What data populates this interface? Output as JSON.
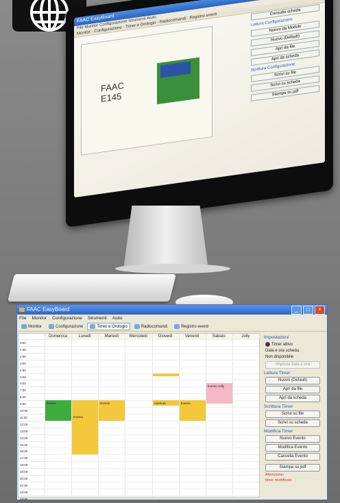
{
  "monitor": {
    "app_title": "FAAC EasyBoard",
    "menu": [
      "File",
      "Monitor",
      "Configurazione",
      "Strumenti",
      "Aiuto"
    ],
    "tabs": [
      "Monitor",
      "Configurazione",
      "Timer e Orologio",
      "Radiocomandi",
      "Registro eventi"
    ],
    "board_label": "FAAC\nE145",
    "side_sections": [
      {
        "title": "",
        "buttons": [
          "Consulta scheda"
        ]
      },
      {
        "title": "Lettura Configurazione",
        "buttons": [
          "Nuovo da Modulo",
          "Nuovo (Default)",
          "Apri da file",
          "Apri da scheda"
        ]
      },
      {
        "title": "Scrittura Configurazione",
        "buttons": [
          "Scrivi su file",
          "Scrivi su scheda"
        ]
      },
      {
        "title": "",
        "buttons": [
          "Stampa su pdf"
        ]
      }
    ]
  },
  "app": {
    "title": "FAAC EasyBoard",
    "menu": [
      "File",
      "Monitor",
      "Configurazione",
      "Strumenti",
      "Aiuto"
    ],
    "tabs": [
      {
        "label": "Monitor",
        "active": false
      },
      {
        "label": "Configurazione",
        "active": false
      },
      {
        "label": "Timer e Orologio",
        "active": true
      },
      {
        "label": "Radiocomandi",
        "active": false
      },
      {
        "label": "Registro eventi",
        "active": false
      }
    ],
    "days": [
      "Domenica",
      "Lunedì",
      "Martedì",
      "Mercoledì",
      "Giovedì",
      "Venerdì",
      "Sabato",
      "Jolly"
    ],
    "times": [
      "0:00",
      "1:00",
      "2:00",
      "3:00",
      "4:00",
      "5:00",
      "6:00",
      "7:00",
      "8:00",
      "9:00",
      "10:00",
      "11:00",
      "12:00",
      "13:00",
      "14:00",
      "15:00",
      "16:00",
      "17:00",
      "18:00",
      "19:00",
      "20:00",
      "21:00",
      "22:00",
      "23:00"
    ],
    "events": [
      {
        "day": 0,
        "start": 9,
        "end": 12,
        "label": "Evento",
        "color": "#3cad3c"
      },
      {
        "day": 1,
        "start": 9,
        "end": 11,
        "label": "",
        "color": "#f3c83a"
      },
      {
        "day": 1,
        "start": 11,
        "end": 17,
        "label": "Evento",
        "color": "#f3c83a"
      },
      {
        "day": 2,
        "start": 9,
        "end": 12,
        "label": "Evento",
        "color": "#f3c83a"
      },
      {
        "day": 4,
        "start": 5,
        "end": 5.4,
        "label": "",
        "color": "#f3c83a"
      },
      {
        "day": 4,
        "start": 9,
        "end": 9.8,
        "label": "Apertura",
        "color": "#f3c83a"
      },
      {
        "day": 5,
        "start": 9,
        "end": 12,
        "label": "Evento",
        "color": "#f3c83a"
      },
      {
        "day": 6,
        "start": 6.5,
        "end": 9.5,
        "label": "Evento Jolly",
        "color": "#f5b8c4"
      }
    ],
    "side": {
      "impostazioni_title": "Impostazioni",
      "timer_attivo": "Timer attivo",
      "data_ora_title": "Data e ora scheda",
      "data_ora_value": "Non disponibile",
      "imposta_data_btn": "Imposta data e ora",
      "lettura_title": "Lettura Timer",
      "lettura_buttons": [
        "Nuovo (Default)",
        "Apri da file",
        "Apri da scheda"
      ],
      "scrittura_title": "Scrittura Timer",
      "scrittura_buttons": [
        "Scrivi su file",
        "Scrivi su scheda"
      ],
      "modifica_title": "Modifica Timer",
      "modifica_buttons": [
        "Nuovo Evento",
        "Modifica Evento",
        "Cancella Evento"
      ],
      "stampa_btn": "Stampa su pdf",
      "warning_title": "Attenzione:",
      "warning_text": "timer modificato"
    }
  }
}
